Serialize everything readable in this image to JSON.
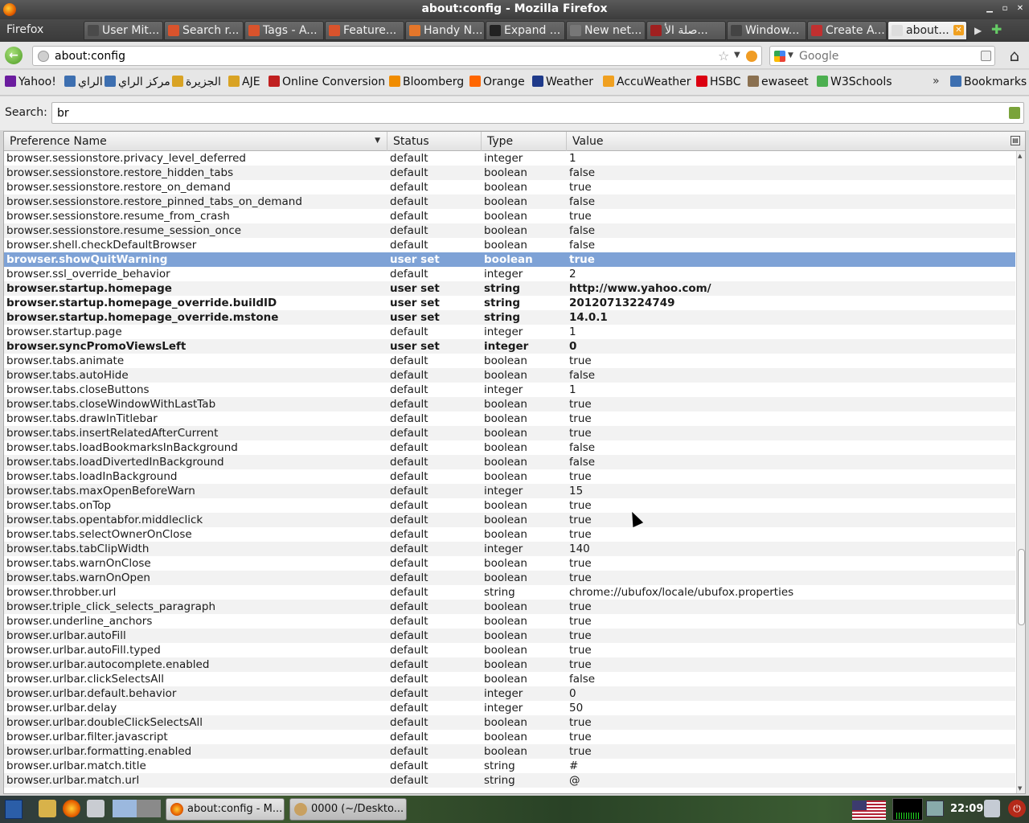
{
  "window": {
    "title": "about:config - Mozilla Firefox"
  },
  "menu_button": "Firefox",
  "tabs": [
    {
      "label": "User Mit...",
      "icon_color": "#4a4a4a"
    },
    {
      "label": "Search r...",
      "icon_color": "#d9532c"
    },
    {
      "label": "Tags - A...",
      "icon_color": "#d9532c"
    },
    {
      "label": "Feature...",
      "icon_color": "#d9532c"
    },
    {
      "label": "Handy N...",
      "icon_color": "#e4762a"
    },
    {
      "label": "Expand ...",
      "icon_color": "#222222"
    },
    {
      "label": "New net...",
      "icon_color": "#777777"
    },
    {
      "label": "صلة الأ...",
      "icon_color": "#a02020"
    },
    {
      "label": "Window...",
      "icon_color": "#444444"
    },
    {
      "label": "Create A...",
      "icon_color": "#c03030"
    },
    {
      "label": "about...",
      "icon_color": "#dddddd",
      "active": true
    }
  ],
  "nav": {
    "url": "about:config",
    "search_placeholder": "Google"
  },
  "bookmarks": [
    {
      "label": "Yahoo!",
      "icon_color": "#6b1c9e"
    },
    {
      "label": "الراي",
      "icon_color": "#3d6fb0"
    },
    {
      "label": "مركز الراي",
      "icon_color": "#3d6fb0"
    },
    {
      "label": "الجزيرة",
      "icon_color": "#d9a324"
    },
    {
      "label": "AJE",
      "icon_color": "#d9a324"
    },
    {
      "label": "Online Conversion",
      "icon_color": "#c02020"
    },
    {
      "label": "Bloomberg",
      "icon_color": "#f08c00"
    },
    {
      "label": "Orange",
      "icon_color": "#ff6600"
    },
    {
      "label": "Weather",
      "icon_color": "#1f3a8a"
    },
    {
      "label": "AccuWeather",
      "icon_color": "#f0a020"
    },
    {
      "label": "HSBC",
      "icon_color": "#db0011"
    },
    {
      "label": "ewaseet",
      "icon_color": "#8a7050"
    },
    {
      "label": "W3Schools",
      "icon_color": "#4caf50"
    }
  ],
  "bookmarks_more": "»",
  "bookmarks_menu": "Bookmarks",
  "config": {
    "search_label": "Search:",
    "search_value": "br",
    "columns": [
      "Preference Name",
      "Status",
      "Type",
      "Value"
    ],
    "rows": [
      {
        "name": "browser.sessionstore.privacy_level_deferred",
        "status": "default",
        "type": "integer",
        "value": "1"
      },
      {
        "name": "browser.sessionstore.restore_hidden_tabs",
        "status": "default",
        "type": "boolean",
        "value": "false"
      },
      {
        "name": "browser.sessionstore.restore_on_demand",
        "status": "default",
        "type": "boolean",
        "value": "true"
      },
      {
        "name": "browser.sessionstore.restore_pinned_tabs_on_demand",
        "status": "default",
        "type": "boolean",
        "value": "false"
      },
      {
        "name": "browser.sessionstore.resume_from_crash",
        "status": "default",
        "type": "boolean",
        "value": "true"
      },
      {
        "name": "browser.sessionstore.resume_session_once",
        "status": "default",
        "type": "boolean",
        "value": "false"
      },
      {
        "name": "browser.shell.checkDefaultBrowser",
        "status": "default",
        "type": "boolean",
        "value": "false"
      },
      {
        "name": "browser.showQuitWarning",
        "status": "user set",
        "type": "boolean",
        "value": "true",
        "selected": true
      },
      {
        "name": "browser.ssl_override_behavior",
        "status": "default",
        "type": "integer",
        "value": "2"
      },
      {
        "name": "browser.startup.homepage",
        "status": "user set",
        "type": "string",
        "value": "http://www.yahoo.com/"
      },
      {
        "name": "browser.startup.homepage_override.buildID",
        "status": "user set",
        "type": "string",
        "value": "20120713224749"
      },
      {
        "name": "browser.startup.homepage_override.mstone",
        "status": "user set",
        "type": "string",
        "value": "14.0.1"
      },
      {
        "name": "browser.startup.page",
        "status": "default",
        "type": "integer",
        "value": "1"
      },
      {
        "name": "browser.syncPromoViewsLeft",
        "status": "user set",
        "type": "integer",
        "value": "0"
      },
      {
        "name": "browser.tabs.animate",
        "status": "default",
        "type": "boolean",
        "value": "true"
      },
      {
        "name": "browser.tabs.autoHide",
        "status": "default",
        "type": "boolean",
        "value": "false"
      },
      {
        "name": "browser.tabs.closeButtons",
        "status": "default",
        "type": "integer",
        "value": "1"
      },
      {
        "name": "browser.tabs.closeWindowWithLastTab",
        "status": "default",
        "type": "boolean",
        "value": "true"
      },
      {
        "name": "browser.tabs.drawInTitlebar",
        "status": "default",
        "type": "boolean",
        "value": "true"
      },
      {
        "name": "browser.tabs.insertRelatedAfterCurrent",
        "status": "default",
        "type": "boolean",
        "value": "true"
      },
      {
        "name": "browser.tabs.loadBookmarksInBackground",
        "status": "default",
        "type": "boolean",
        "value": "false"
      },
      {
        "name": "browser.tabs.loadDivertedInBackground",
        "status": "default",
        "type": "boolean",
        "value": "false"
      },
      {
        "name": "browser.tabs.loadInBackground",
        "status": "default",
        "type": "boolean",
        "value": "true"
      },
      {
        "name": "browser.tabs.maxOpenBeforeWarn",
        "status": "default",
        "type": "integer",
        "value": "15"
      },
      {
        "name": "browser.tabs.onTop",
        "status": "default",
        "type": "boolean",
        "value": "true"
      },
      {
        "name": "browser.tabs.opentabfor.middleclick",
        "status": "default",
        "type": "boolean",
        "value": "true"
      },
      {
        "name": "browser.tabs.selectOwnerOnClose",
        "status": "default",
        "type": "boolean",
        "value": "true"
      },
      {
        "name": "browser.tabs.tabClipWidth",
        "status": "default",
        "type": "integer",
        "value": "140"
      },
      {
        "name": "browser.tabs.warnOnClose",
        "status": "default",
        "type": "boolean",
        "value": "true"
      },
      {
        "name": "browser.tabs.warnOnOpen",
        "status": "default",
        "type": "boolean",
        "value": "true"
      },
      {
        "name": "browser.throbber.url",
        "status": "default",
        "type": "string",
        "value": "chrome://ubufox/locale/ubufox.properties"
      },
      {
        "name": "browser.triple_click_selects_paragraph",
        "status": "default",
        "type": "boolean",
        "value": "true"
      },
      {
        "name": "browser.underline_anchors",
        "status": "default",
        "type": "boolean",
        "value": "true"
      },
      {
        "name": "browser.urlbar.autoFill",
        "status": "default",
        "type": "boolean",
        "value": "true"
      },
      {
        "name": "browser.urlbar.autoFill.typed",
        "status": "default",
        "type": "boolean",
        "value": "true"
      },
      {
        "name": "browser.urlbar.autocomplete.enabled",
        "status": "default",
        "type": "boolean",
        "value": "true"
      },
      {
        "name": "browser.urlbar.clickSelectsAll",
        "status": "default",
        "type": "boolean",
        "value": "false"
      },
      {
        "name": "browser.urlbar.default.behavior",
        "status": "default",
        "type": "integer",
        "value": "0"
      },
      {
        "name": "browser.urlbar.delay",
        "status": "default",
        "type": "integer",
        "value": "50"
      },
      {
        "name": "browser.urlbar.doubleClickSelectsAll",
        "status": "default",
        "type": "boolean",
        "value": "true"
      },
      {
        "name": "browser.urlbar.filter.javascript",
        "status": "default",
        "type": "boolean",
        "value": "true"
      },
      {
        "name": "browser.urlbar.formatting.enabled",
        "status": "default",
        "type": "boolean",
        "value": "true"
      },
      {
        "name": "browser.urlbar.match.title",
        "status": "default",
        "type": "string",
        "value": "#"
      },
      {
        "name": "browser.urlbar.match.url",
        "status": "default",
        "type": "string",
        "value": "@"
      }
    ]
  },
  "taskbar": {
    "tasks": [
      {
        "label": "about:config - M...",
        "active": true
      },
      {
        "label": "0000 (~/Deskto...",
        "active": false
      }
    ],
    "clock": "22:09"
  },
  "colors": {
    "selection": "#7ea2d6",
    "row_alt": "#f2f2f2"
  }
}
